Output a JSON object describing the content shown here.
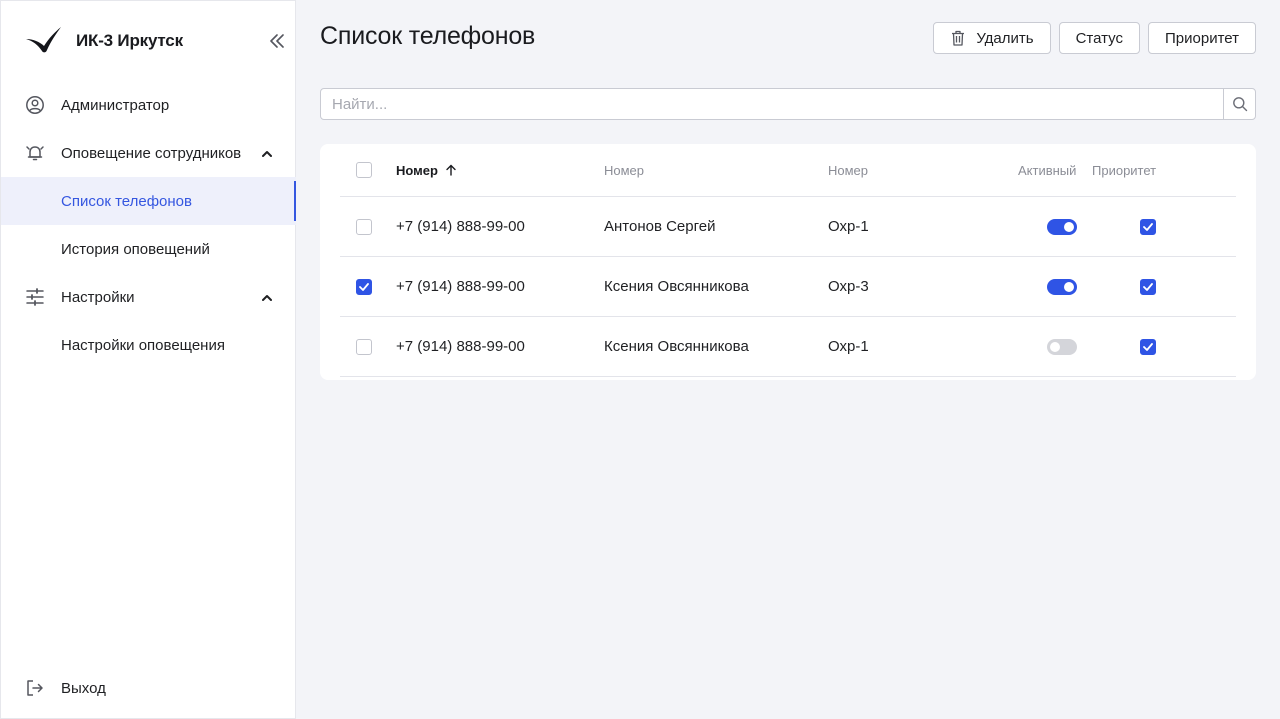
{
  "brand": {
    "name": "ИК-3 Иркутск"
  },
  "sidebar": {
    "items": [
      {
        "label": "Администратор",
        "icon": "user-circle-icon"
      },
      {
        "label": "Оповещение сотрудников",
        "icon": "bell-icon",
        "expanded": true
      },
      {
        "label": "Список телефонов",
        "active": true
      },
      {
        "label": "История оповещений"
      },
      {
        "label": "Настройки",
        "icon": "sliders-icon",
        "expanded": true
      },
      {
        "label": "Настройки оповещения"
      }
    ],
    "logout_label": "Выход"
  },
  "page": {
    "title": "Список телефонов"
  },
  "toolbar": {
    "delete_label": "Удалить",
    "status_label": "Статус",
    "priority_label": "Приоритет"
  },
  "search": {
    "placeholder": "Найти..."
  },
  "table": {
    "columns": [
      "Номер",
      "Номер",
      "Номер",
      "Активный",
      "Приоритет"
    ],
    "sorted_column": 0,
    "rows": [
      {
        "selected": false,
        "phone": "+7 (914) 888-99-00",
        "name": "Антонов Сергей",
        "post": "Охр-1",
        "active": true,
        "priority": true
      },
      {
        "selected": true,
        "phone": "+7 (914) 888-99-00",
        "name": "Ксения Овсянникова",
        "post": "Охр-3",
        "active": true,
        "priority": true
      },
      {
        "selected": false,
        "phone": "+7 (914) 888-99-00",
        "name": "Ксения Овсянникова",
        "post": "Охр-1",
        "active": false,
        "priority": true
      }
    ]
  },
  "colors": {
    "accent": "#2f54e5",
    "background": "#f3f4f8"
  }
}
